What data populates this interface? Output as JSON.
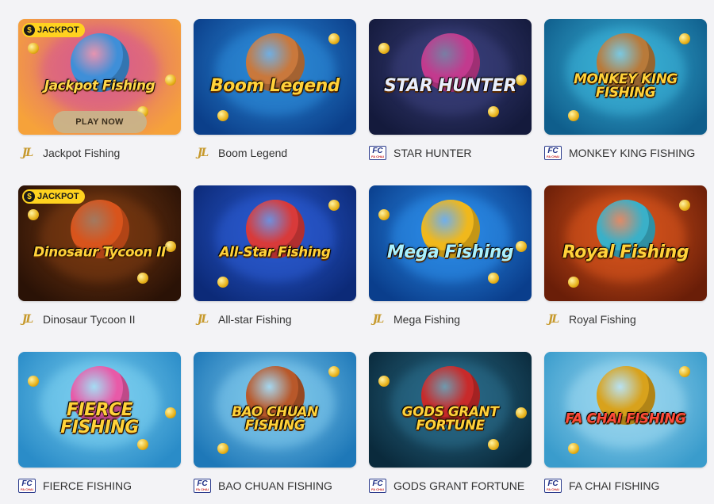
{
  "play_now_label": "PLAY NOW",
  "jackpot_label": "JACKPOT",
  "jackpot_symbol": "$",
  "providers": {
    "jl": {
      "icon": "jl-provider-logo",
      "text": "JL",
      "color": "#c79a2e"
    },
    "fc": {
      "icon": "fc-provider-logo",
      "text": "FC",
      "subtext": "FA CHAI",
      "color": "#1f2f85"
    }
  },
  "games": [
    {
      "title": "Jackpot Fishing",
      "logo": "Jackpot Fishing",
      "provider": "jl",
      "jackpot": true,
      "play_now": true,
      "bg": [
        "#d85a8e",
        "#f6a23a"
      ],
      "char": "#3f8fd8",
      "logo_color": "#ffd84a"
    },
    {
      "title": "Boom Legend",
      "logo": "Boom Legend",
      "provider": "jl",
      "jackpot": false,
      "bg": [
        "#2c8ad8",
        "#0b3f8a"
      ],
      "char": "#c9783c",
      "logo_color": "#ffd23a"
    },
    {
      "title": "STAR HUNTER",
      "logo": "STAR HUNTER",
      "provider": "fc",
      "jackpot": false,
      "bg": [
        "#3a3f7a",
        "#141a3c"
      ],
      "char": "#c23a8e",
      "logo_color": "#e8eefc"
    },
    {
      "title": "MONKEY KING FISHING",
      "logo": "MONKEY KING FISHING",
      "provider": "fc",
      "jackpot": false,
      "bg": [
        "#3bb2d8",
        "#0f5e8c"
      ],
      "char": "#b87a3a",
      "logo_color": "#ffd23a"
    },
    {
      "title": "Dinosaur Tycoon II",
      "logo": "Dinosaur Tycoon II",
      "provider": "jl",
      "jackpot": true,
      "bg": [
        "#7a3a12",
        "#2a1206"
      ],
      "char": "#d8541c",
      "logo_color": "#ffd23a"
    },
    {
      "title": "All-star Fishing",
      "logo": "All-Star Fishing",
      "provider": "jl",
      "jackpot": false,
      "bg": [
        "#2a5ad0",
        "#0c2a78"
      ],
      "char": "#d83a3a",
      "logo_color": "#ffd23a"
    },
    {
      "title": "Mega Fishing",
      "logo": "Mega Fishing",
      "provider": "jl",
      "jackpot": false,
      "bg": [
        "#2b8ce8",
        "#0a3e8c"
      ],
      "char": "#f0b81c",
      "logo_color": "#a8f0ff"
    },
    {
      "title": "Royal Fishing",
      "logo": "Royal Fishing",
      "provider": "jl",
      "jackpot": false,
      "bg": [
        "#d8541c",
        "#6a1e08"
      ],
      "char": "#3ab0c8",
      "logo_color": "#ffd23a"
    },
    {
      "title": "FIERCE FISHING",
      "logo": "FIERCE FISHING",
      "provider": "fc",
      "jackpot": false,
      "bg": [
        "#7cd0f0",
        "#2a8cc8"
      ],
      "char": "#e85aa8",
      "logo_color": "#ffd23a"
    },
    {
      "title": "BAO CHUAN FISHING",
      "logo": "BAO CHUAN FISHING",
      "provider": "fc",
      "jackpot": false,
      "bg": [
        "#7fc8ec",
        "#1e78b8"
      ],
      "char": "#b8582a",
      "logo_color": "#ffd23a"
    },
    {
      "title": "GODS GRANT FORTUNE",
      "logo": "GODS GRANT FORTUNE",
      "provider": "fc",
      "jackpot": false,
      "bg": [
        "#2a6c8a",
        "#0a2a3c"
      ],
      "char": "#c82a2a",
      "logo_color": "#ffd23a"
    },
    {
      "title": "FA CHAI FISHING",
      "logo": "FA CHAI FISHING",
      "provider": "fc",
      "jackpot": false,
      "bg": [
        "#9cd8f0",
        "#3a9ccc"
      ],
      "char": "#d8a21c",
      "logo_color": "#ff4a3a"
    }
  ]
}
